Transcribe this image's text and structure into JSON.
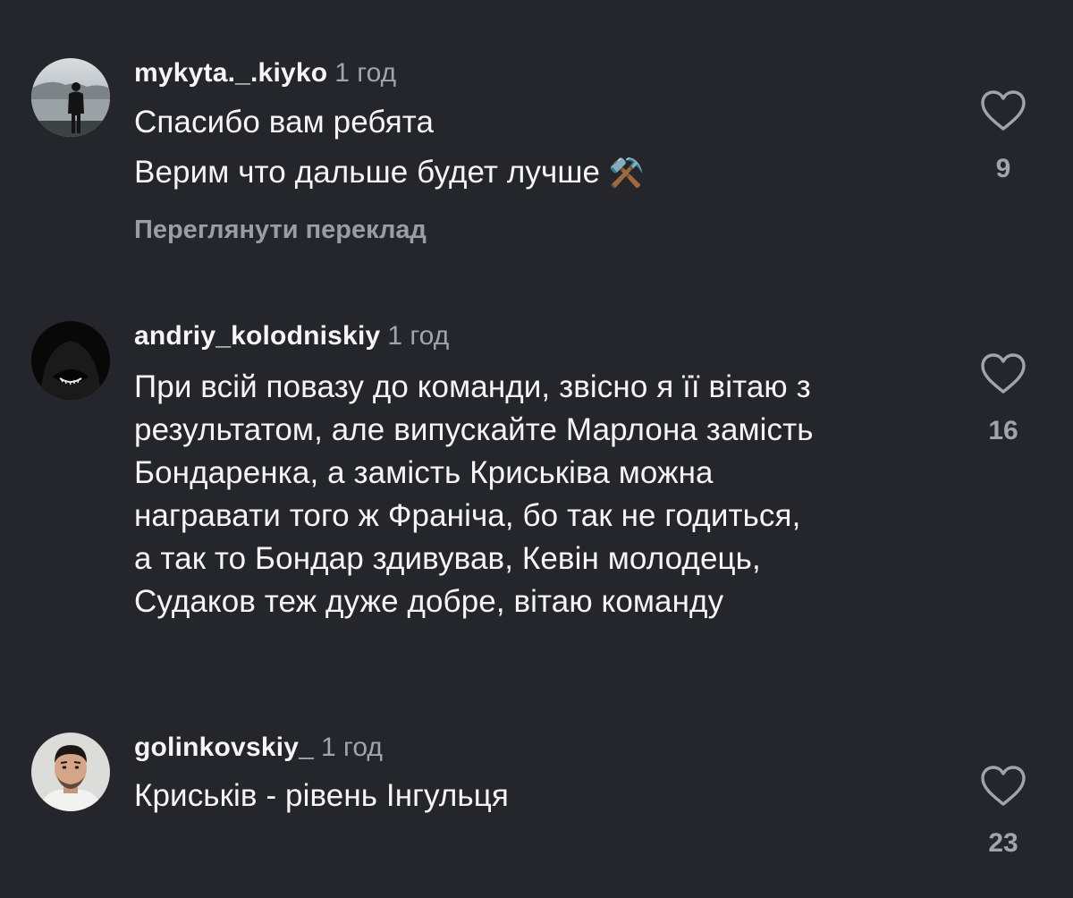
{
  "comments": [
    {
      "username": "mykyta._.kiyko",
      "time": "1 год",
      "lines": [
        "Спасибо вам ребята",
        "Верим что дальше будет лучше"
      ],
      "emoji": "⚒️",
      "translate_label": "Переглянути переклад",
      "likes": "9"
    },
    {
      "username": "andriy_kolodniskiy",
      "time": "1 год",
      "lines": [
        "При всій повазу до команди, звісно я її вітаю з",
        "результатом, але випускайте Марлона замість",
        "Бондаренка, а замість Криськіва можна",
        "награвати того ж Франіча, бо так не годиться,",
        "а так то Бондар здивував, Кевін молодець,",
        "Судаков теж дуже добре, вітаю команду"
      ],
      "likes": "16"
    },
    {
      "username": "golinkovskiy_",
      "time": "1 год",
      "lines": [
        "Криськів - рівень Інгульця"
      ],
      "likes": "23"
    }
  ],
  "icons": {
    "like": "heart-outline-icon",
    "avatar_1": "avatar-lake-silhouette",
    "avatar_2": "avatar-dark-hood",
    "avatar_3": "avatar-man-portrait"
  },
  "colors": {
    "background": "#25262b",
    "text": "#f5f5f5",
    "secondary": "#a3a4aa"
  }
}
